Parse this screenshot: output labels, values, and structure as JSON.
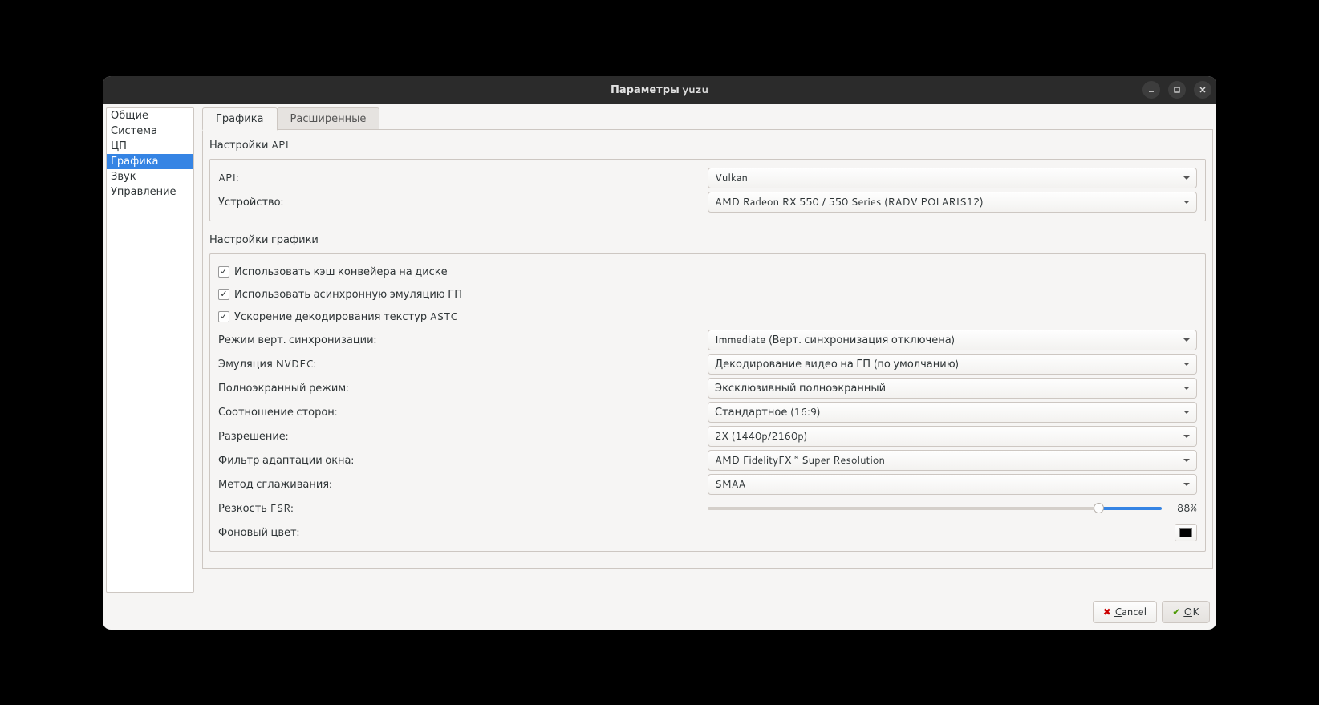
{
  "titlebar": {
    "title": "Параметры yuzu"
  },
  "sidebar": {
    "items": [
      {
        "label": "Общие"
      },
      {
        "label": "Система"
      },
      {
        "label": "ЦП"
      },
      {
        "label": "Графика"
      },
      {
        "label": "Звук"
      },
      {
        "label": "Управление"
      }
    ],
    "selected_index": 3
  },
  "tabs": [
    {
      "label": "Графика"
    },
    {
      "label": "Расширенные"
    }
  ],
  "api_section": {
    "title": "Настройки API",
    "api_label": "API:",
    "api_value": "Vulkan",
    "device_label": "Устройство:",
    "device_value": "AMD Radeon RX 550 / 550 Series (RADV POLARIS12)"
  },
  "gfx_section": {
    "title": "Настройки графики",
    "check_pipeline": "Использовать кэш конвейера на диске",
    "check_async_gpu": "Использовать асинхронную эмуляцию ГП",
    "check_astc": "Ускорение декодирования текстур ASTC",
    "vsync_label": "Режим верт. синхронизации:",
    "vsync_value": "Immediate (Верт. синхронизация отключена)",
    "nvdec_label": "Эмуляция NVDEC:",
    "nvdec_value": "Декодирование видео на ГП (по умолчанию)",
    "fullscreen_label": "Полноэкранный режим:",
    "fullscreen_value": "Эксклюзивный полноэкранный",
    "aspect_label": "Соотношение сторон:",
    "aspect_value": "Стандартное (16:9)",
    "resolution_label": "Разрешение:",
    "resolution_value": "2X (1440p/2160p)",
    "filter_label": "Фильтр адаптации окна:",
    "filter_value": "AMD FidelityFX™ Super Resolution",
    "aa_label": "Метод сглаживания:",
    "aa_value": "SMAA",
    "fsr_label": "Резкость FSR:",
    "fsr_value": "88%",
    "bg_label": "Фоновый цвет:",
    "bg_color": "#000000"
  },
  "buttons": {
    "cancel": "Cancel",
    "ok": "OK"
  }
}
